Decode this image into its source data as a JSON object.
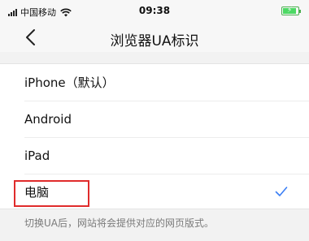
{
  "status_bar": {
    "carrier": "中国移动",
    "time": "09:38"
  },
  "nav": {
    "title": "浏览器UA标识"
  },
  "ua_options": [
    {
      "label": "iPhone（默认）",
      "selected": false
    },
    {
      "label": "Android",
      "selected": false
    },
    {
      "label": "iPad",
      "selected": false
    },
    {
      "label": "电脑",
      "selected": true
    }
  ],
  "footnote": "切换UA后，网站将会提供对应的网页版式。",
  "colors": {
    "checkmark": "#3b7ff5",
    "highlight_box": "#e02b2b",
    "battery": "#4cd964"
  }
}
